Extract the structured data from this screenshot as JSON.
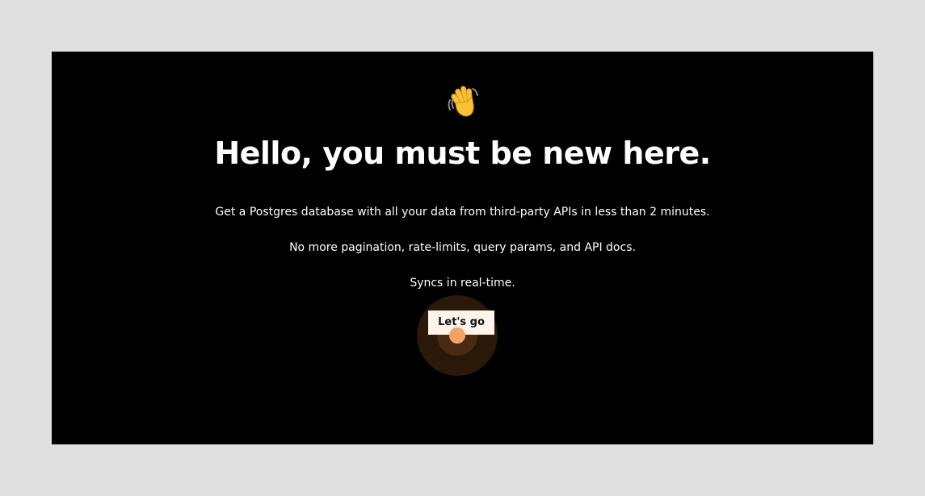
{
  "hero": {
    "icon": "waving-hand-icon",
    "title": "Hello, you must be new here.",
    "lines": [
      "Get a Postgres database with all your data from third-party APIs in less than 2 minutes.",
      "No more pagination, rate-limits, query params, and API docs.",
      "Syncs in real-time."
    ]
  },
  "cta": {
    "label": "Let's go"
  },
  "colors": {
    "page_background": "#e0e0e0",
    "frame_background": "#000000",
    "text": "#ffffff",
    "button_background": "#fff4ea",
    "accent_dot": "#f5a266",
    "ripple_outer": "#2a1808",
    "ripple_inner": "#4a2a10"
  }
}
